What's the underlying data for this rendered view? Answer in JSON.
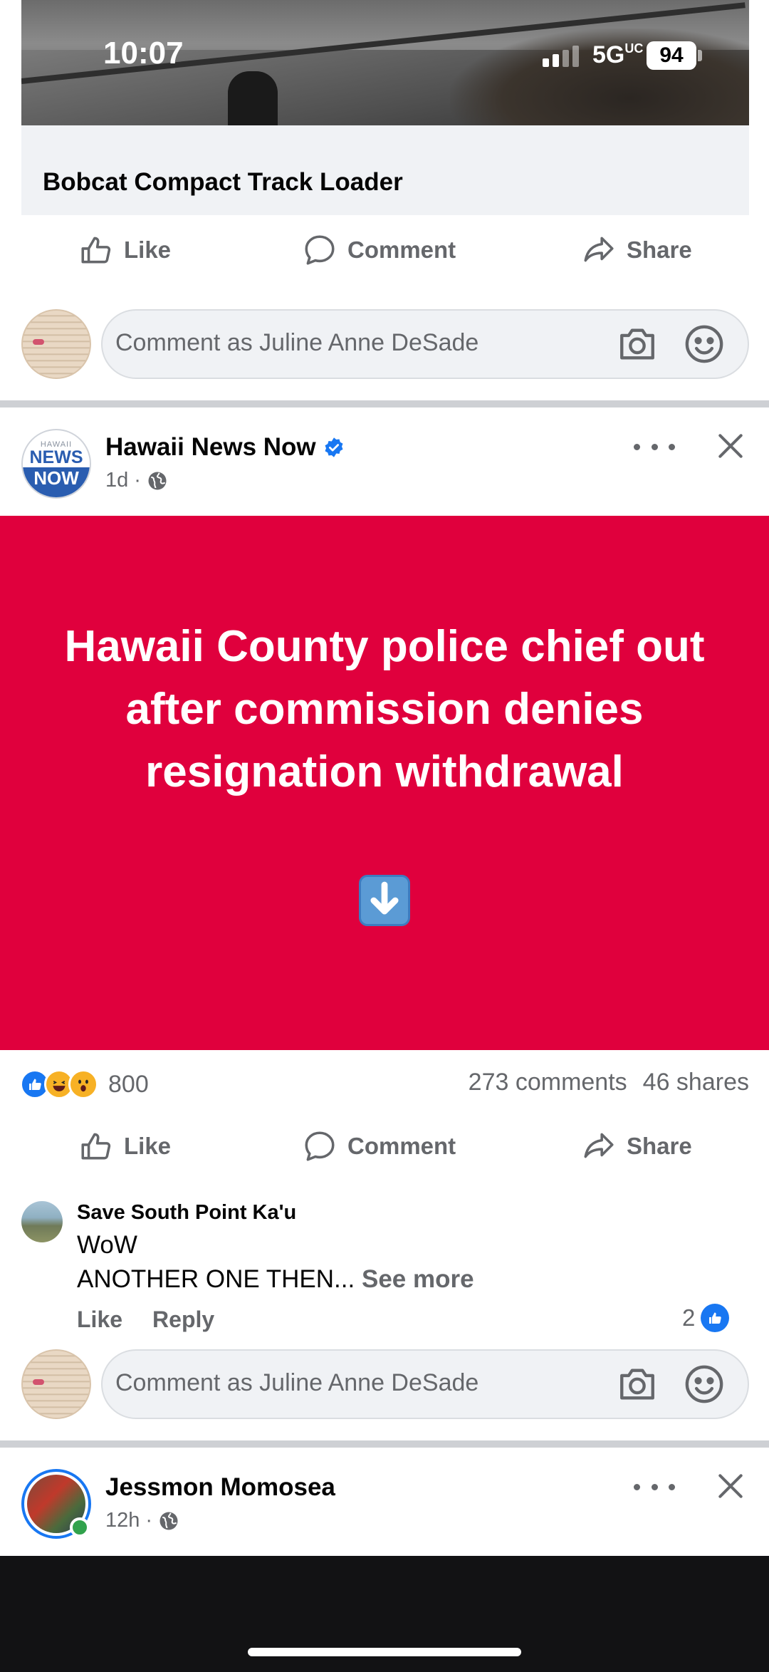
{
  "status_bar": {
    "time": "10:07",
    "network": "5G",
    "network_badge": "UC",
    "battery": "94"
  },
  "previous_post": {
    "caption": "Bobcat Compact Track Loader",
    "actions": {
      "like": "Like",
      "comment": "Comment",
      "share": "Share"
    },
    "composer_placeholder": "Comment as Juline Anne DeSade"
  },
  "post": {
    "author": "Hawaii News Now",
    "verified": true,
    "time": "1d",
    "separator": "·",
    "logo": {
      "top": "HAWAII",
      "middle": "NEWS",
      "bottom": "NOW"
    },
    "headline": "Hawaii County police chief out after commission denies resignation withdrawal",
    "emoji": "down-arrow-emoji",
    "reaction_count": "800",
    "comments_count": "273 comments",
    "shares_count": "46 shares",
    "actions": {
      "like": "Like",
      "comment": "Comment",
      "share": "Share"
    },
    "top_comment": {
      "author": "Save South Point Ka'u",
      "line1": "WoW",
      "line2": "ANOTHER ONE THEN...",
      "see_more": "See more",
      "like": "Like",
      "reply": "Reply",
      "likes": "2"
    },
    "composer_placeholder": "Comment as Juline Anne DeSade"
  },
  "next_post": {
    "author": "Jessmon Momosea",
    "time": "12h",
    "separator": "·"
  },
  "colors": {
    "facebook_blue": "#1877f2",
    "headline_bg": "#e0003d",
    "muted_text": "#65676b"
  }
}
